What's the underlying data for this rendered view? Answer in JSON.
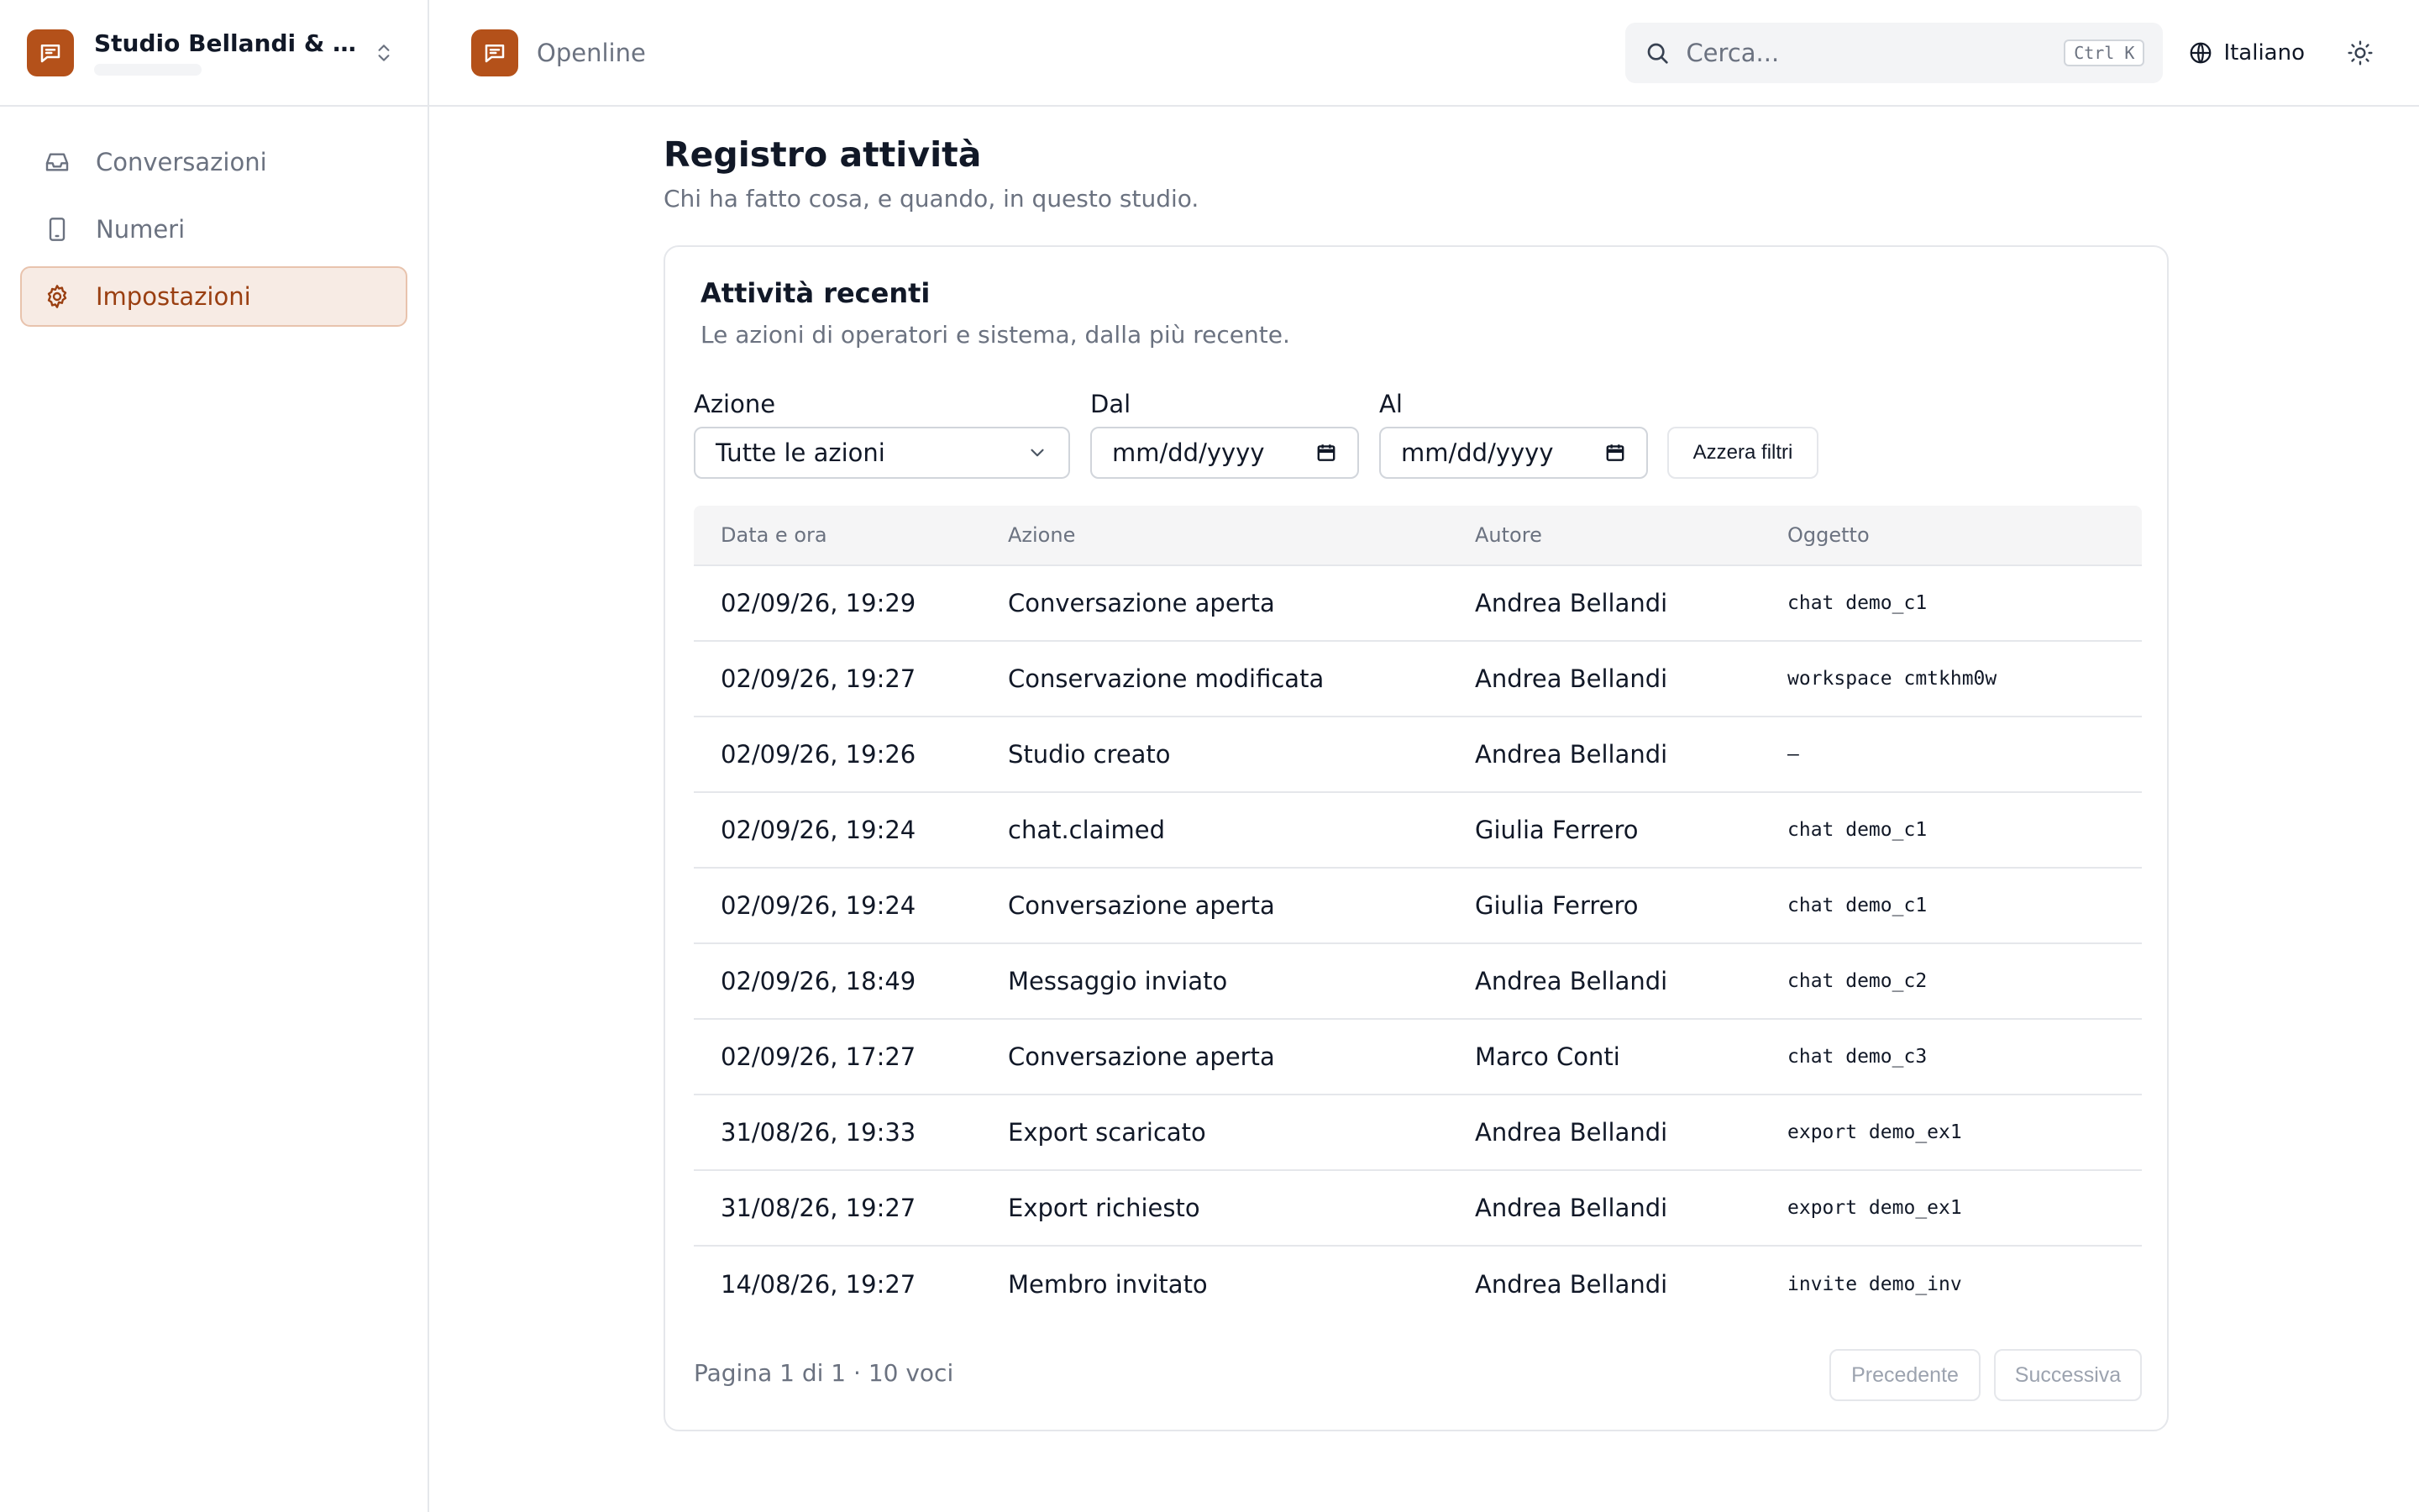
{
  "workspace": {
    "name": "Studio Bellandi & A...",
    "chevron_icon": "chevron-up-down-icon"
  },
  "sidebar": {
    "items": [
      {
        "label": "Conversazioni",
        "icon": "inbox-icon",
        "active": false
      },
      {
        "label": "Numeri",
        "icon": "phone-icon",
        "active": false
      },
      {
        "label": "Impostazioni",
        "icon": "gear-icon",
        "active": true
      }
    ]
  },
  "topbar": {
    "brand": "Openline",
    "search_placeholder": "Cerca...",
    "search_shortcut": "Ctrl K",
    "language": "Italiano",
    "theme_icon": "sun-icon"
  },
  "page": {
    "title": "Registro attività",
    "subtitle": "Chi ha fatto cosa, e quando, in questo studio."
  },
  "card": {
    "title": "Attività recenti",
    "subtitle": "Le azioni di operatori e sistema, dalla più recente."
  },
  "filters": {
    "action_label": "Azione",
    "action_value": "Tutte le azioni",
    "from_label": "Dal",
    "from_value": "mm/dd/yyyy",
    "to_label": "Al",
    "to_value": "mm/dd/yyyy",
    "reset_label": "Azzera filtri"
  },
  "table": {
    "columns": [
      "Data e ora",
      "Azione",
      "Autore",
      "Oggetto"
    ],
    "rows": [
      [
        "02/09/26, 19:29",
        "Conversazione aperta",
        "Andrea Bellandi",
        "chat demo_c1"
      ],
      [
        "02/09/26, 19:27",
        "Conservazione modificata",
        "Andrea Bellandi",
        "workspace cmtkhm0w"
      ],
      [
        "02/09/26, 19:26",
        "Studio creato",
        "Andrea Bellandi",
        "—"
      ],
      [
        "02/09/26, 19:24",
        "chat.claimed",
        "Giulia Ferrero",
        "chat demo_c1"
      ],
      [
        "02/09/26, 19:24",
        "Conversazione aperta",
        "Giulia Ferrero",
        "chat demo_c1"
      ],
      [
        "02/09/26, 18:49",
        "Messaggio inviato",
        "Andrea Bellandi",
        "chat demo_c2"
      ],
      [
        "02/09/26, 17:27",
        "Conversazione aperta",
        "Marco Conti",
        "chat demo_c3"
      ],
      [
        "31/08/26, 19:33",
        "Export scaricato",
        "Andrea Bellandi",
        "export demo_ex1"
      ],
      [
        "31/08/26, 19:27",
        "Export richiesto",
        "Andrea Bellandi",
        "export demo_ex1"
      ],
      [
        "14/08/26, 19:27",
        "Membro invitato",
        "Andrea Bellandi",
        "invite demo_inv"
      ]
    ]
  },
  "pagination": {
    "summary": "Pagina 1 di 1 · 10 voci",
    "prev_label": "Precedente",
    "next_label": "Successiva"
  },
  "colors": {
    "accent": "#b4511a",
    "accent_bg": "#f7ebe4",
    "accent_text": "#9a3f11"
  }
}
